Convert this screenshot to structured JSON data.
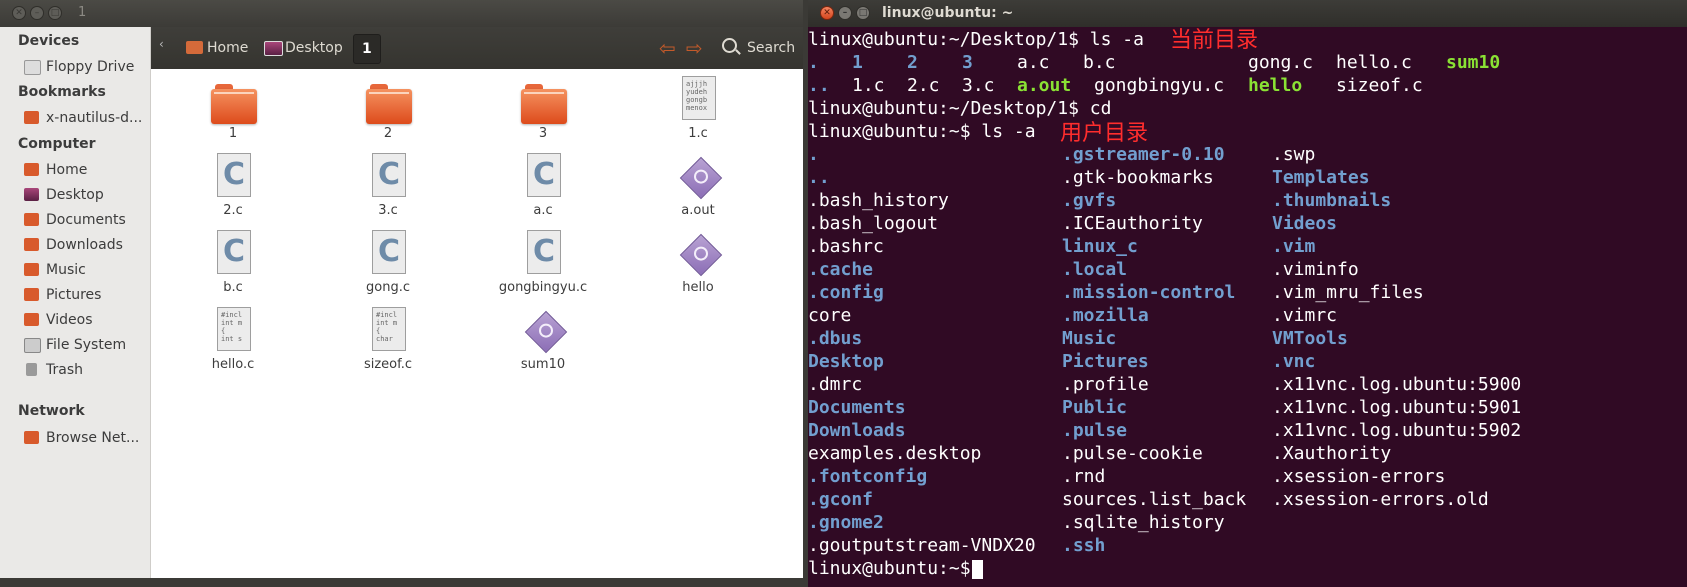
{
  "nautilus": {
    "title": "1",
    "breadcrumb": {
      "home": "Home",
      "desktop": "Desktop",
      "current": "1"
    },
    "search_label": "Search",
    "sidebar": {
      "devices_heading": "Devices",
      "devices": [
        "Floppy Drive"
      ],
      "bookmarks_heading": "Bookmarks",
      "bookmarks": [
        "x-nautilus-d..."
      ],
      "computer_heading": "Computer",
      "computer": [
        "Home",
        "Desktop",
        "Documents",
        "Downloads",
        "Music",
        "Pictures",
        "Videos",
        "File System",
        "Trash"
      ],
      "network_heading": "Network",
      "network": [
        "Browse Net..."
      ]
    },
    "files": [
      {
        "name": "1",
        "icon": "folder-icon"
      },
      {
        "name": "2",
        "icon": "folder-icon"
      },
      {
        "name": "3",
        "icon": "folder-icon"
      },
      {
        "name": "1.c",
        "icon": "text-file-icon",
        "preview": "ajjjh\nyudeh\ngongb\nmenox"
      },
      {
        "name": "2.c",
        "icon": "c-source-icon"
      },
      {
        "name": "3.c",
        "icon": "c-source-icon"
      },
      {
        "name": "a.c",
        "icon": "c-source-icon"
      },
      {
        "name": "a.out",
        "icon": "executable-icon"
      },
      {
        "name": "b.c",
        "icon": "c-source-icon"
      },
      {
        "name": "gong.c",
        "icon": "c-source-icon"
      },
      {
        "name": "gongbingyu.c",
        "icon": "c-source-icon"
      },
      {
        "name": "hello",
        "icon": "executable-icon"
      },
      {
        "name": "hello.c",
        "icon": "text-file-icon",
        "preview": "#incl\nint m\n{\nint s"
      },
      {
        "name": "sizeof.c",
        "icon": "text-file-icon",
        "preview": "#incl\nint m\n{\nchar"
      },
      {
        "name": "sum10",
        "icon": "executable-icon"
      }
    ]
  },
  "terminal": {
    "title": "linux@ubuntu: ~",
    "annotations": {
      "current_dir": "当前目录",
      "user_dir": "用户目录"
    },
    "colors": {
      "background": "#300a24",
      "directory": "#729fcf",
      "executable": "#8ae234",
      "annotation": "#ff2d2d"
    },
    "lines": {
      "prompt1": "linux@ubuntu:~/Desktop/1$ ls -a",
      "prompt2": "linux@ubuntu:~/Desktop/1$ cd",
      "prompt3": "linux@ubuntu:~$ ls -a",
      "prompt4": "linux@ubuntu:~$"
    },
    "desktop_listing": [
      {
        "name": ".",
        "kind": "dir"
      },
      {
        "name": "1",
        "kind": "dir"
      },
      {
        "name": "2",
        "kind": "dir"
      },
      {
        "name": "3",
        "kind": "dir"
      },
      {
        "name": "a.c",
        "kind": "file"
      },
      {
        "name": "b.c",
        "kind": "file"
      },
      {
        "name": "gong.c",
        "kind": "file"
      },
      {
        "name": "hello.c",
        "kind": "file"
      },
      {
        "name": "sum10",
        "kind": "exe"
      },
      {
        "name": "..",
        "kind": "dir"
      },
      {
        "name": "1.c",
        "kind": "file"
      },
      {
        "name": "2.c",
        "kind": "file"
      },
      {
        "name": "3.c",
        "kind": "file"
      },
      {
        "name": "a.out",
        "kind": "exe"
      },
      {
        "name": "gongbingyu.c",
        "kind": "file"
      },
      {
        "name": "hello",
        "kind": "exe"
      },
      {
        "name": "sizeof.c",
        "kind": "file"
      }
    ],
    "home_listing": {
      "col1": [
        {
          "name": ".",
          "kind": "dir"
        },
        {
          "name": "..",
          "kind": "dir"
        },
        {
          "name": ".bash_history",
          "kind": "file"
        },
        {
          "name": ".bash_logout",
          "kind": "file"
        },
        {
          "name": ".bashrc",
          "kind": "file"
        },
        {
          "name": ".cache",
          "kind": "dir"
        },
        {
          "name": ".config",
          "kind": "dir"
        },
        {
          "name": "core",
          "kind": "file"
        },
        {
          "name": ".dbus",
          "kind": "dir"
        },
        {
          "name": "Desktop",
          "kind": "dir"
        },
        {
          "name": ".dmrc",
          "kind": "file"
        },
        {
          "name": "Documents",
          "kind": "dir"
        },
        {
          "name": "Downloads",
          "kind": "dir"
        },
        {
          "name": "examples.desktop",
          "kind": "file"
        },
        {
          "name": ".fontconfig",
          "kind": "dir"
        },
        {
          "name": ".gconf",
          "kind": "dir"
        },
        {
          "name": ".gnome2",
          "kind": "dir"
        },
        {
          "name": ".goutputstream-VNDX20",
          "kind": "file"
        }
      ],
      "col2": [
        {
          "name": ".gstreamer-0.10",
          "kind": "dir"
        },
        {
          "name": ".gtk-bookmarks",
          "kind": "file"
        },
        {
          "name": ".gvfs",
          "kind": "dir"
        },
        {
          "name": ".ICEauthority",
          "kind": "file"
        },
        {
          "name": "linux_c",
          "kind": "dir"
        },
        {
          "name": ".local",
          "kind": "dir"
        },
        {
          "name": ".mission-control",
          "kind": "dir"
        },
        {
          "name": ".mozilla",
          "kind": "dir"
        },
        {
          "name": "Music",
          "kind": "dir"
        },
        {
          "name": "Pictures",
          "kind": "dir"
        },
        {
          "name": ".profile",
          "kind": "file"
        },
        {
          "name": "Public",
          "kind": "dir"
        },
        {
          "name": ".pulse",
          "kind": "dir"
        },
        {
          "name": ".pulse-cookie",
          "kind": "file"
        },
        {
          "name": ".rnd",
          "kind": "file"
        },
        {
          "name": "sources.list_back",
          "kind": "file"
        },
        {
          "name": ".sqlite_history",
          "kind": "file"
        },
        {
          "name": ".ssh",
          "kind": "dir"
        }
      ],
      "col3": [
        {
          "name": ".swp",
          "kind": "file"
        },
        {
          "name": "Templates",
          "kind": "dir"
        },
        {
          "name": ".thumbnails",
          "kind": "dir"
        },
        {
          "name": "Videos",
          "kind": "dir"
        },
        {
          "name": ".vim",
          "kind": "dir"
        },
        {
          "name": ".viminfo",
          "kind": "file"
        },
        {
          "name": ".vim_mru_files",
          "kind": "file"
        },
        {
          "name": ".vimrc",
          "kind": "file"
        },
        {
          "name": "VMTools",
          "kind": "dir"
        },
        {
          "name": ".vnc",
          "kind": "dir"
        },
        {
          "name": ".x11vnc.log.ubuntu:5900",
          "kind": "file"
        },
        {
          "name": ".x11vnc.log.ubuntu:5901",
          "kind": "file"
        },
        {
          "name": ".x11vnc.log.ubuntu:5902",
          "kind": "file"
        },
        {
          "name": ".Xauthority",
          "kind": "file"
        },
        {
          "name": ".xsession-errors",
          "kind": "file"
        },
        {
          "name": ".xsession-errors.old",
          "kind": "file"
        }
      ]
    }
  }
}
